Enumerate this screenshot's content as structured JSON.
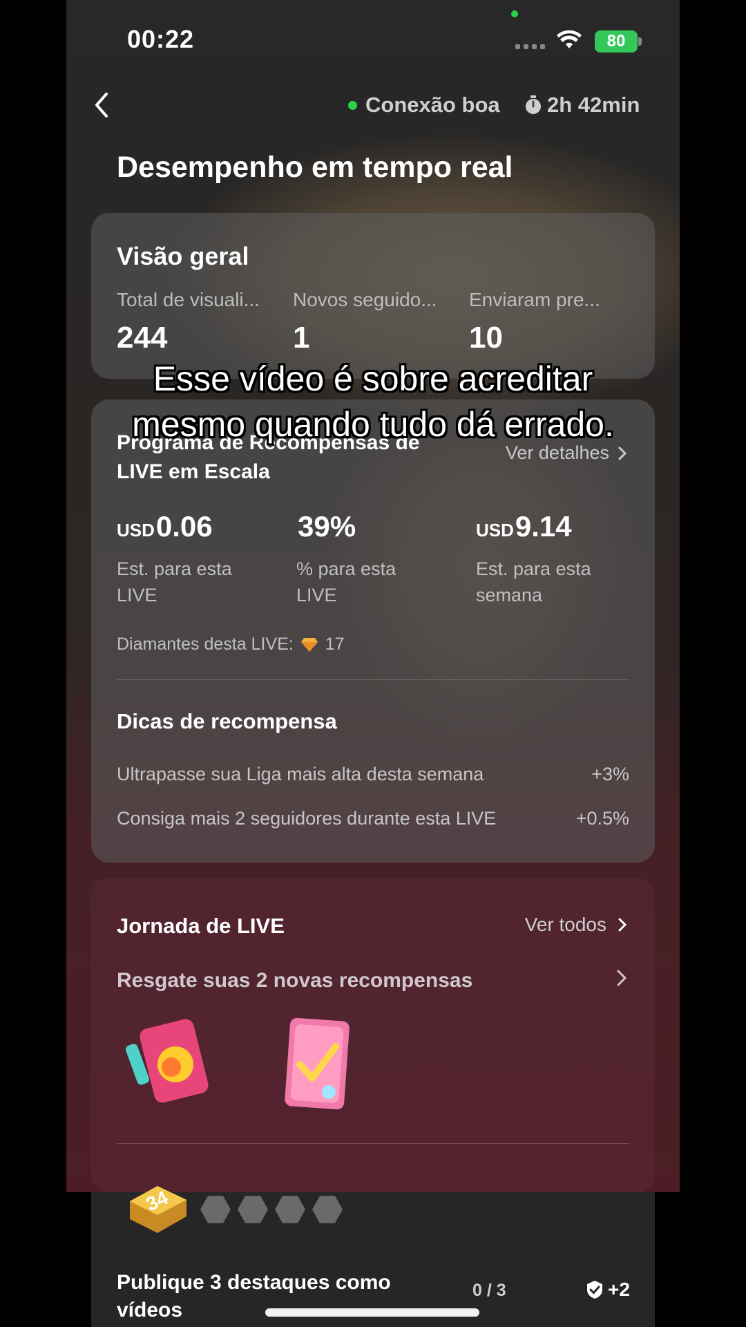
{
  "status_bar": {
    "time": "00:22",
    "battery": "80"
  },
  "header": {
    "connection": "Conexão boa",
    "duration": "2h 42min",
    "title": "Desempenho em tempo real"
  },
  "overview": {
    "title": "Visão geral",
    "stats": [
      {
        "label": "Total de visuali...",
        "value": "244"
      },
      {
        "label": "Novos seguido...",
        "value": "1"
      },
      {
        "label": "Enviaram pre...",
        "value": "10"
      }
    ]
  },
  "rewards_program": {
    "title_line1": "Programa de Recompensas de",
    "title_line2": "LIVE em Escala",
    "details_label": "Ver detalhes",
    "stats": [
      {
        "currency": "USD",
        "value": "0.06",
        "desc": "Est. para esta LIVE"
      },
      {
        "currency": "",
        "value": "39%",
        "desc": "% para esta LIVE"
      },
      {
        "currency": "USD",
        "value": "9.14",
        "desc": "Est. para esta semana"
      }
    ],
    "diamonds_label": "Diamantes desta LIVE:",
    "diamonds_value": "17",
    "tips_title": "Dicas de recompensa",
    "tips": [
      {
        "text": "Ultrapasse sua Liga mais alta desta semana",
        "bonus": "+3%"
      },
      {
        "text": "Consiga mais 2 seguidores durante esta LIVE",
        "bonus": "+0.5%"
      }
    ]
  },
  "journey": {
    "title": "Jornada de LIVE",
    "view_all": "Ver todos",
    "claim_text": "Resgate suas 2 novas recompensas",
    "level": "34",
    "task": {
      "title": "Publique 3 destaques como vídeos",
      "progress_text": "0 / 3",
      "reward": "+2",
      "progress": 0
    }
  },
  "caption": {
    "line1": "Esse vídeo é sobre acreditar",
    "line2": "mesmo quando tudo dá errado."
  }
}
